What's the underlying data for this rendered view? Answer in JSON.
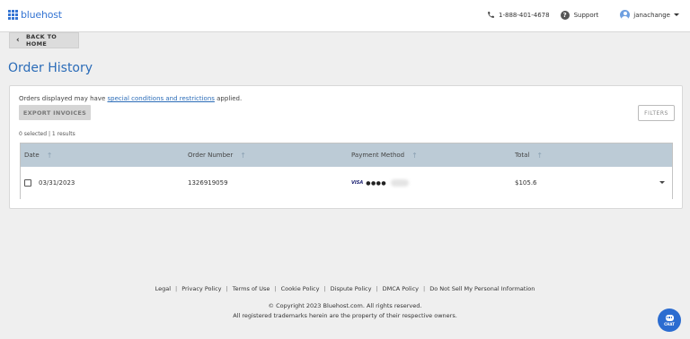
{
  "header": {
    "logo_text": "bluehost",
    "phone": "1-888-401-4678",
    "support": "Support",
    "username": "janachange"
  },
  "nav": {
    "back_label": "BACK TO HOME"
  },
  "page": {
    "title": "Order History"
  },
  "orders": {
    "notice_prefix": "Orders displayed may have ",
    "notice_link": "special conditions and restrictions",
    "notice_suffix": " applied.",
    "export_label": "EXPORT INVOICES",
    "filters_label": "FILTERS",
    "selection_summary": "0 selected | 1 results",
    "columns": [
      "Date",
      "Order Number",
      "Payment Method",
      "Total"
    ],
    "rows": [
      {
        "date": "03/31/2023",
        "order_number": "1326919059",
        "card_brand": "VISA",
        "card_mask": "●●●●",
        "total": "$105.6"
      }
    ]
  },
  "footer": {
    "links": [
      "Legal",
      "Privacy Policy",
      "Terms of Use",
      "Cookie Policy",
      "Dispute Policy",
      "DMCA Policy",
      "Do Not Sell My Personal Information"
    ],
    "copyright": "© Copyright 2023 Bluehost.com. All rights reserved.",
    "trademark": "All registered trademarks herein are the property of their respective owners."
  },
  "chat": {
    "label": "CHAT"
  },
  "icons": {
    "logo": "grid-icon",
    "phone": "phone-icon",
    "support": "help-icon",
    "account": "avatar-icon",
    "back": "chevron-left-icon",
    "sort": "arrow-up-icon",
    "expand": "caret-down-icon",
    "chat": "chat-icon"
  },
  "colors": {
    "brand": "#3575d3",
    "title": "#2b6cb8",
    "table_header": "#bccbd6",
    "background": "#efefef"
  }
}
